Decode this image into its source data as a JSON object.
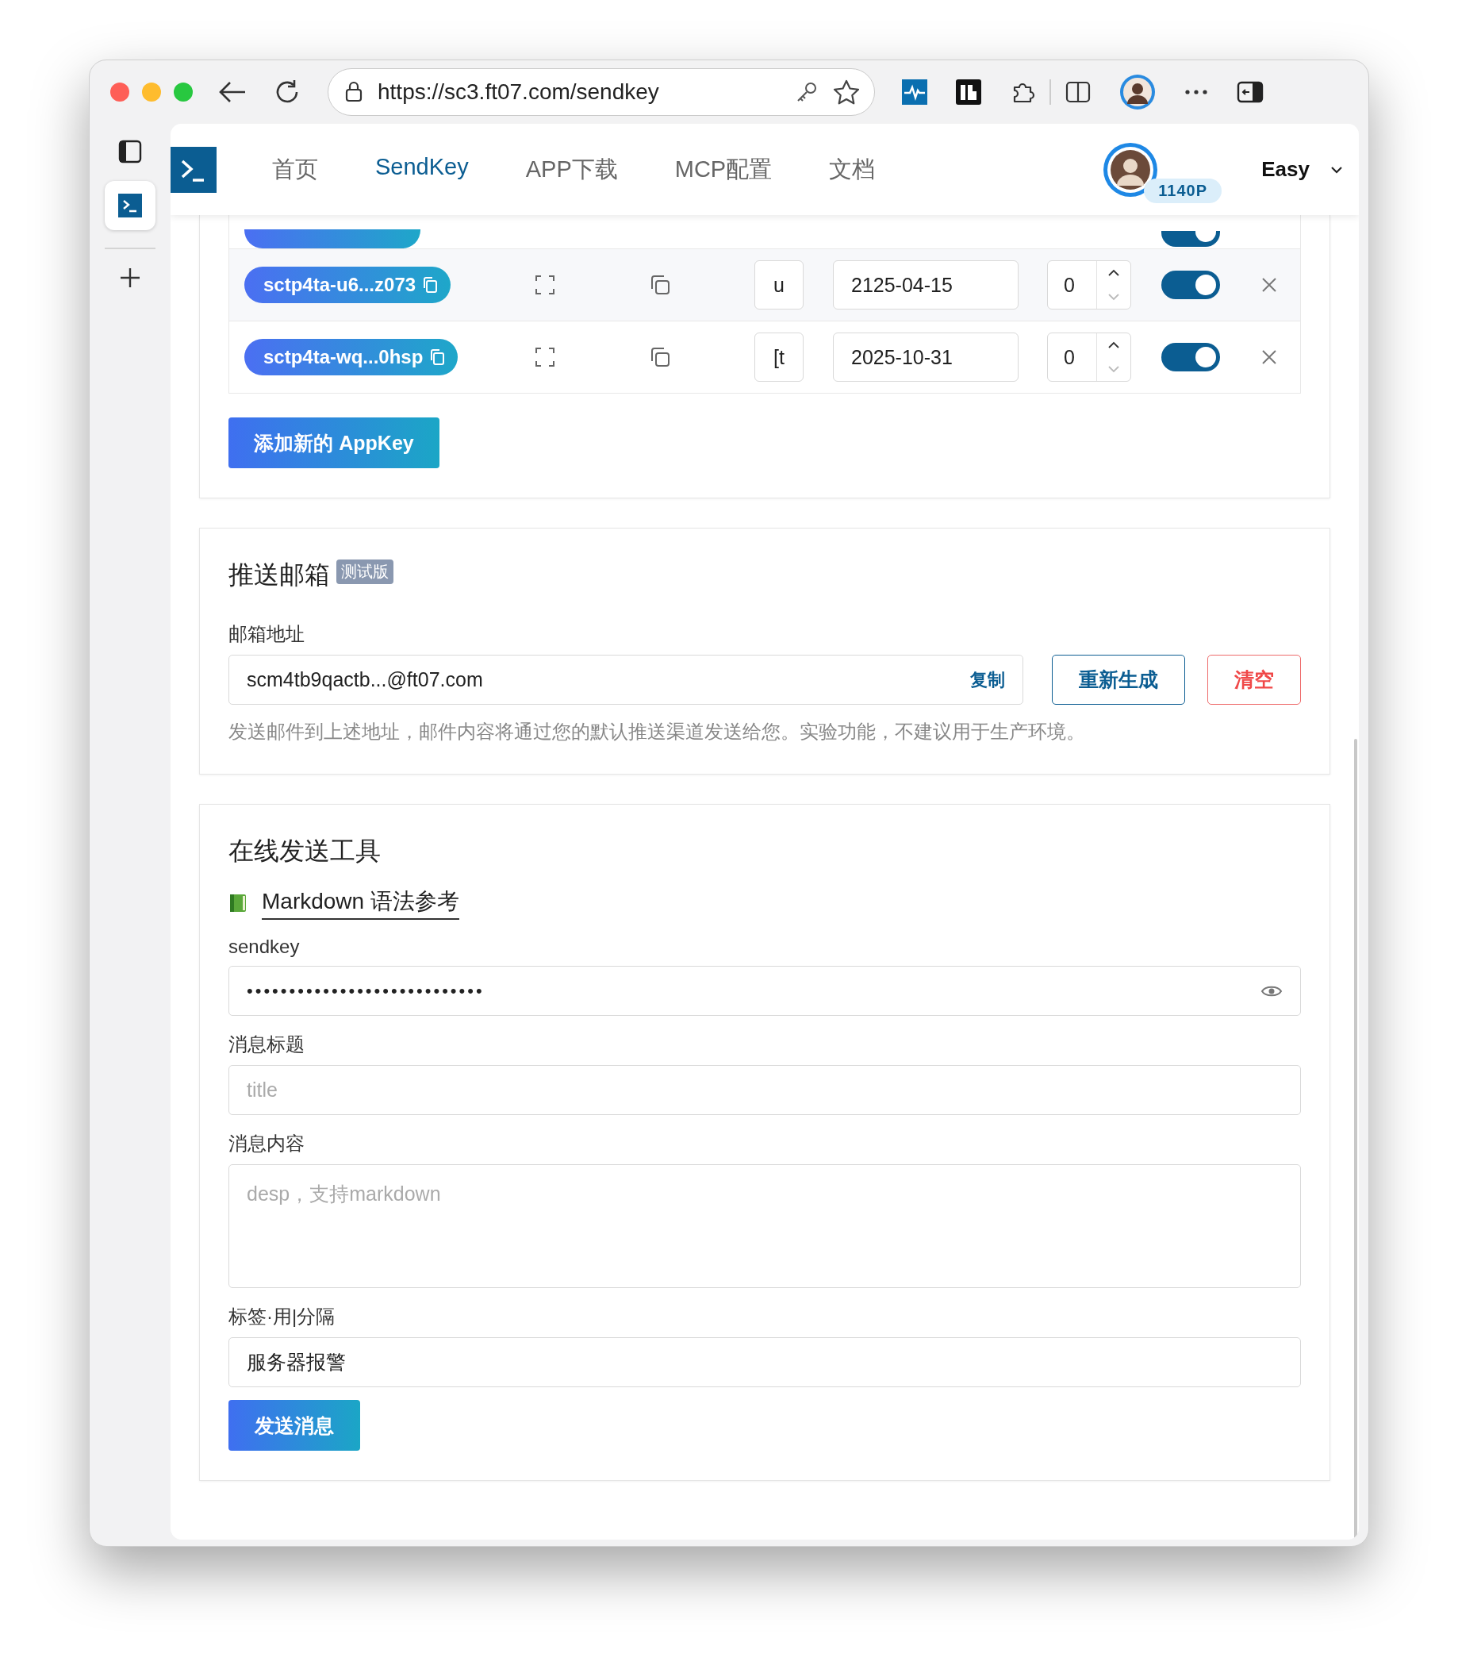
{
  "browser": {
    "url": "https://sc3.ft07.com/sendkey"
  },
  "nav": {
    "items": [
      {
        "label": "首页",
        "selected": false
      },
      {
        "label": "SendKey",
        "selected": true
      },
      {
        "label": "APP下载",
        "selected": false
      },
      {
        "label": "MCP配置",
        "selected": false
      },
      {
        "label": "文档",
        "selected": false
      }
    ],
    "points": "1140P",
    "user": "Easy"
  },
  "appkeys": {
    "rows": [
      {
        "kind": "covered",
        "enabled": true
      },
      {
        "kind": "full",
        "key": "sctp4ta-u6...z073",
        "tag": "u",
        "expiry": "2125-04-15",
        "count": "0",
        "enabled": true
      },
      {
        "kind": "full",
        "key": "sctp4ta-wq...0hsp",
        "tag": "[t",
        "expiry": "2025-10-31",
        "count": "0",
        "enabled": true
      }
    ],
    "add_button": "添加新的 AppKey"
  },
  "email": {
    "title": "推送邮箱",
    "badge": "测试版",
    "label": "邮箱地址",
    "address": "scm4tb9qactb...@ft07.com",
    "copy": "复制",
    "regenerate": "重新生成",
    "clear": "清空",
    "help": "发送邮件到上述地址，邮件内容将通过您的默认推送渠道发送给您。实验功能，不建议用于生产环境。"
  },
  "sender": {
    "title": "在线发送工具",
    "markdown_link": "Markdown 语法参考",
    "fields": [
      {
        "kind": "secret",
        "label": "sendkey",
        "value": "••••••••••••••••••••••••••••"
      },
      {
        "kind": "text",
        "label": "消息标题",
        "placeholder": "title"
      },
      {
        "kind": "textarea",
        "label": "消息内容",
        "placeholder": "desp，支持markdown"
      },
      {
        "kind": "text",
        "label": "标签·用|分隔",
        "value": "服务器报警"
      }
    ],
    "send_button": "发送消息"
  }
}
